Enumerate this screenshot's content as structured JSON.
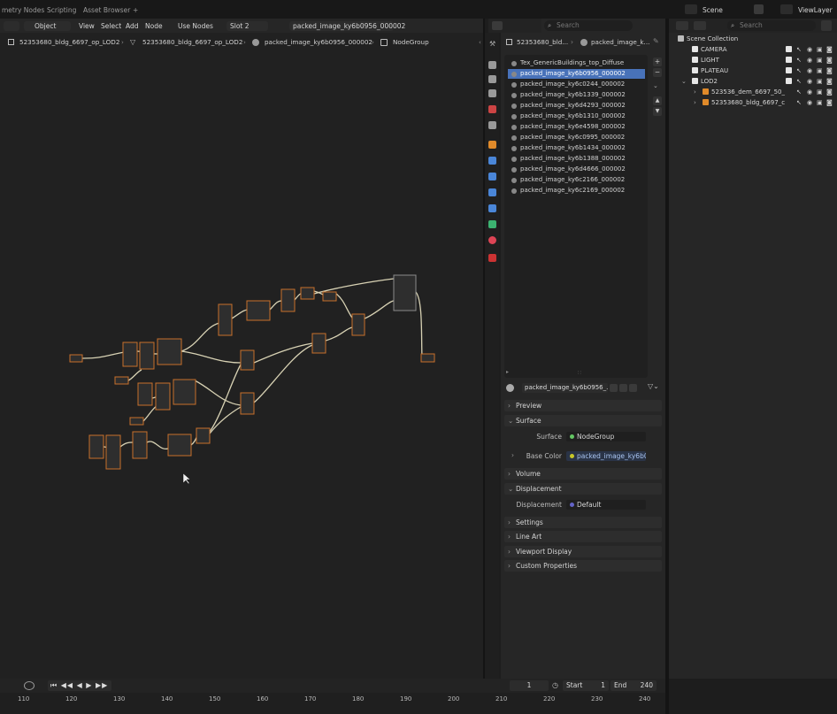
{
  "top_tabs": [
    "metry Nodes",
    "Scripting",
    "Asset Browser",
    "+"
  ],
  "scene": {
    "label": "Scene",
    "view_layer": "ViewLayer"
  },
  "editor_header": {
    "mode": "Object",
    "menus": [
      "View",
      "Select",
      "Add",
      "Node"
    ],
    "use_nodes_label": "Use Nodes",
    "slot": "Slot 2",
    "material_name": "packed_image_ky6b0956_000002"
  },
  "breadcrumb": [
    "52353680_bldg_6697_op_LOD2",
    "52353680_bldg_6697_op_LOD2",
    "packed_image_ky6b0956_000002",
    "NodeGroup"
  ],
  "side_search_placeholder": "Search",
  "properties": {
    "object_crumb": "52353680_bld...",
    "material_crumb": "packed_image_k...",
    "slots": [
      "Tex_GenericBuildings_top_Diffuse",
      "packed_image_ky6b0956_000002",
      "packed_image_ky6c0244_000002",
      "packed_image_ky6b1339_000002",
      "packed_image_ky6d4293_000002",
      "packed_image_ky6b1310_000002",
      "packed_image_ky6e4598_000002",
      "packed_image_ky6c0995_000002",
      "packed_image_ky6b1434_000002",
      "packed_image_ky6b1388_000002",
      "packed_image_ky6d4666_000002",
      "packed_image_ky6c2166_000002",
      "packed_image_ky6c2169_000002"
    ],
    "selected_slot_index": 1,
    "material_field": "packed_image_ky6b0956_...",
    "panels": {
      "preview": "Preview",
      "surface": "Surface",
      "volume": "Volume",
      "displacement": "Displacement",
      "settings": "Settings",
      "line_art": "Line Art",
      "viewport_display": "Viewport Display",
      "custom_properties": "Custom Properties"
    },
    "surface_label": "Surface",
    "surface_value": "NodeGroup",
    "base_color_label": "Base Color",
    "base_color_value": "packed_image_ky6b0...",
    "displacement_label": "Displacement",
    "displacement_value": "Default"
  },
  "outliner": {
    "search_placeholder": "Search",
    "collection": "Scene Collection",
    "items": [
      "CAMERA",
      "LIGHT",
      "PLATEAU",
      "LOD2",
      "523536_dem_6697_50_",
      "52353680_bldg_6697_c"
    ]
  },
  "timeline": {
    "current_frame": "1",
    "start_label": "Start",
    "start": "1",
    "end_label": "End",
    "end": "240",
    "ruler": [
      "110",
      "120",
      "130",
      "140",
      "150",
      "160",
      "170",
      "180",
      "190",
      "200",
      "210",
      "220",
      "230",
      "240"
    ]
  },
  "colors": {
    "accent": "#4872b9",
    "node_border": "#c8702a",
    "wire": "#d8d2b4",
    "socket_green": "#63c763",
    "socket_yellow": "#c7c729",
    "socket_purple": "#6363c7"
  }
}
